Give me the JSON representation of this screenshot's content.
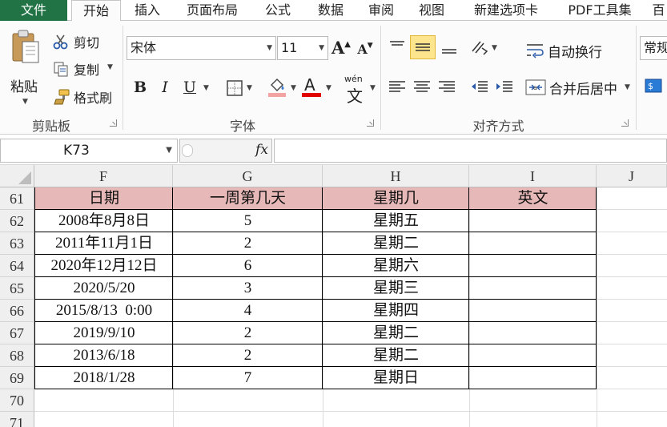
{
  "menu_tabs": [
    "文件",
    "开始",
    "插入",
    "页面布局",
    "公式",
    "数据",
    "审阅",
    "视图",
    "新建选项卡",
    "PDF工具集",
    "百"
  ],
  "active_tab": "开始",
  "clipboard": {
    "paste_label": "粘贴",
    "cut_label": "剪切",
    "copy_label": "复制",
    "format_painter_label": "格式刷",
    "group_label": "剪贴板"
  },
  "font": {
    "font_name": "宋体",
    "font_size": "11",
    "bold": "B",
    "italic": "I",
    "underline": "U",
    "font_color_glyph": "A",
    "phonetic_glyph": "wén",
    "phonetic_char": "文",
    "grow_glyph": "A",
    "shrink_glyph": "A",
    "group_label": "字体"
  },
  "alignment": {
    "wrap_text_label": "自动换行",
    "merge_center_label": "合并后居中",
    "group_label": "对齐方式"
  },
  "number": {
    "format_label": "常规"
  },
  "formula_bar": {
    "name_box": "K73",
    "fx_label": "fx",
    "formula": ""
  },
  "sheet": {
    "columns": [
      "F",
      "G",
      "H",
      "I",
      "J"
    ],
    "rows": [
      "61",
      "62",
      "63",
      "64",
      "65",
      "66",
      "67",
      "68",
      "69",
      "70",
      "71"
    ],
    "table_header": [
      "日期",
      "一周第几天",
      "星期几",
      "英文"
    ],
    "table_rows": [
      [
        "2008年8月8日",
        "5",
        "星期五",
        ""
      ],
      [
        "2011年11月1日",
        "2",
        "星期二",
        ""
      ],
      [
        "2020年12月12日",
        "6",
        "星期六",
        ""
      ],
      [
        "2020/5/20",
        "3",
        "星期三",
        ""
      ],
      [
        "2015/8/13  0:00",
        "4",
        "星期四",
        ""
      ],
      [
        "2019/9/10",
        "2",
        "星期二",
        ""
      ],
      [
        "2013/6/18",
        "2",
        "星期二",
        ""
      ],
      [
        "2018/1/28",
        "7",
        "星期日",
        ""
      ]
    ]
  },
  "colors": {
    "file_tab": "#217346",
    "header_fill": "#e6b8b7",
    "active_align": "#fde58d",
    "font_color_bar": "#e00000",
    "fill_color_bar": "#f4a3a3"
  }
}
